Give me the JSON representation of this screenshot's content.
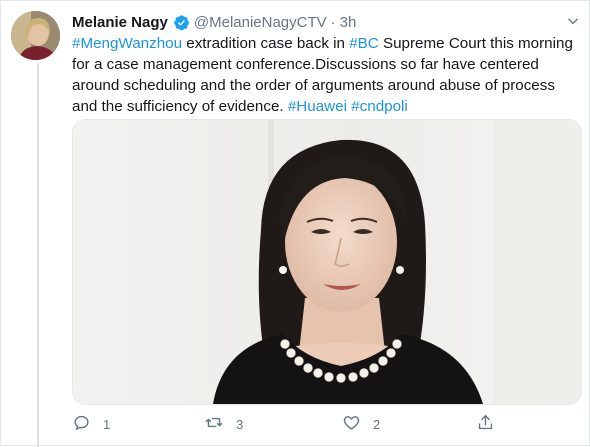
{
  "tweet": {
    "author_name": "Melanie Nagy",
    "handle": "@MelanieNagyCTV",
    "separator": "·",
    "time": "3h",
    "text_segments": [
      {
        "text": "#MengWanzhou",
        "type": "hashtag"
      },
      {
        "text": " extradition case back in ",
        "type": "text"
      },
      {
        "text": "#BC",
        "type": "hashtag"
      },
      {
        "text": " Supreme Court this morning for a case management conference.Discussions so far have centered around scheduling and the order of arguments around abuse of process and the sufficiency of evidence. ",
        "type": "text"
      },
      {
        "text": "#Huawei",
        "type": "hashtag"
      },
      {
        "text": " ",
        "type": "text"
      },
      {
        "text": "#cndpoli",
        "type": "hashtag"
      }
    ]
  },
  "actions": {
    "reply_count": "1",
    "retweet_count": "3",
    "like_count": "2"
  },
  "icons": {
    "verified": "verified-badge-icon",
    "menu": "chevron-down-icon",
    "reply": "reply-icon",
    "retweet": "retweet-icon",
    "like": "heart-icon",
    "share": "share-icon"
  },
  "colors": {
    "hashtag": "#1b95e0",
    "verified": "#1da1f2",
    "secondary_text": "#657786"
  }
}
